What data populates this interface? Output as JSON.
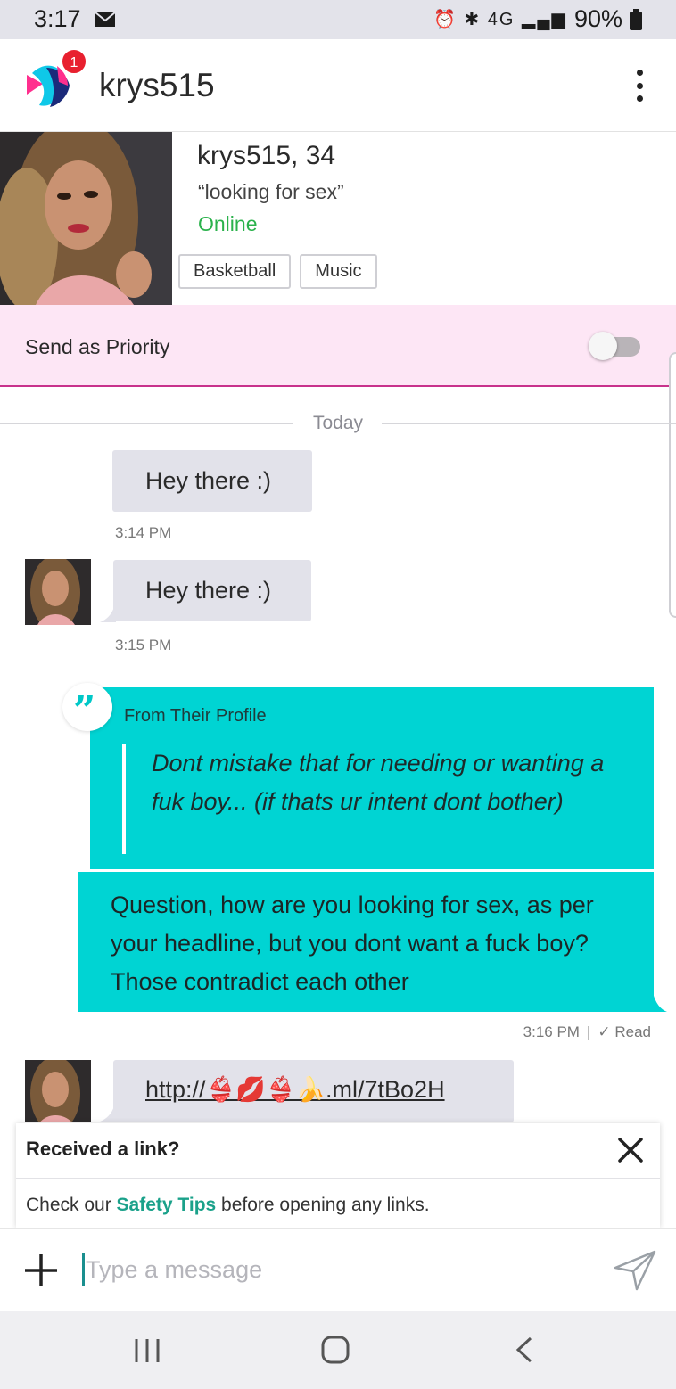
{
  "status_bar": {
    "time": "3:17",
    "indicators": "⏰ ✱ 4G ▂▄▆",
    "battery": "90%"
  },
  "header": {
    "title": "krys515",
    "notification_count": "1"
  },
  "profile": {
    "name_age": "krys515, 34",
    "headline": "“looking for sex”",
    "status": "Online",
    "tags": [
      "Basketball",
      "Music"
    ]
  },
  "priority": {
    "label": "Send as Priority",
    "enabled": false
  },
  "divider": {
    "label": "Today"
  },
  "messages": {
    "m1": {
      "text": "Hey there :)",
      "time": "3:14 PM"
    },
    "m2": {
      "text": "Hey there :)",
      "time": "3:15 PM"
    },
    "quote": {
      "title": "From Their Profile",
      "text": "Dont mistake that for needing or wanting a fuk boy... (if thats ur intent dont bother)"
    },
    "m3": {
      "text": "Question, how are you looking for sex, as per your headline, but you dont want a fuck boy? Those contradict each other",
      "time": "3:16 PM",
      "separator": "|",
      "receipt": "✓ Read"
    },
    "m4": {
      "link": "http://👙💋👙🍌.ml/7tBo2H"
    }
  },
  "link_notice": {
    "title": "Received a link?",
    "body_prefix": "Check our ",
    "body_link": "Safety Tips",
    "body_suffix": " before opening any links."
  },
  "composer": {
    "placeholder": "Type a message"
  },
  "colors": {
    "accent": "#00d4d3",
    "priority_bg": "#fde6f5",
    "priority_border": "#c8328c",
    "online": "#2bb24c",
    "safety_link": "#1aa18a"
  },
  "icons": [
    "mail-icon",
    "app-logo-icon",
    "more-vert-icon",
    "quote-icon",
    "check-icon",
    "close-icon",
    "plus-icon",
    "send-icon",
    "recents-icon",
    "home-icon",
    "back-icon"
  ]
}
